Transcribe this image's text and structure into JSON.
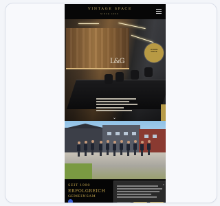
{
  "header": {
    "brand_name": "VINTAGE SPACE",
    "brand_sub": "SINCE 1990",
    "menu_icon": "hamburger-icon"
  },
  "hero": {
    "wall_sign": "L&G",
    "badge_lines": [
      "UNSERE",
      "WERTE"
    ],
    "chevron": "⌄"
  },
  "footer": {
    "title_lines": [
      "SEIT 1990",
      "ERFOLGREICH",
      "GEMEINSAM"
    ],
    "icon": "chat-icon"
  },
  "cookie": {
    "close": "×"
  },
  "colors": {
    "gold": "#bfa14b",
    "dark": "#0a0a0a",
    "card_bg": "#f8f9fc"
  }
}
